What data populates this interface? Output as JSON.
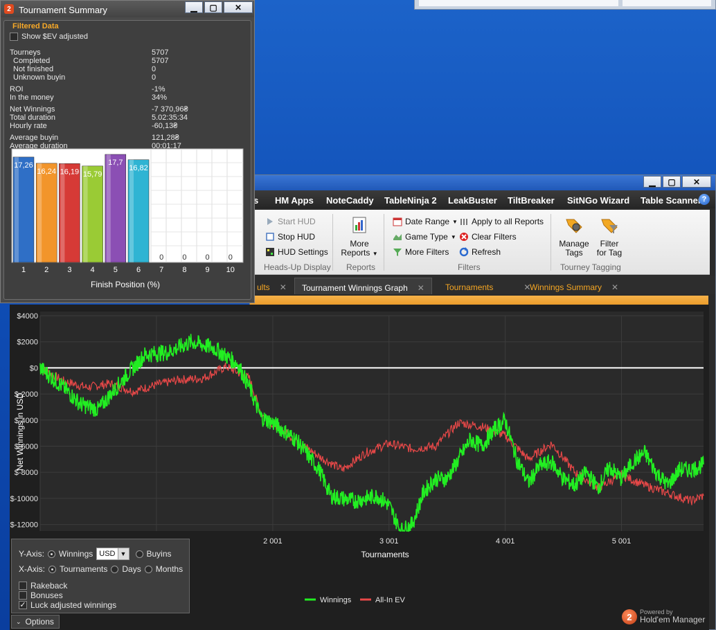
{
  "summary": {
    "title": "Tournament Summary",
    "logo": "2",
    "section": "Filtered Data",
    "ev_checkbox": "Show $EV adjusted",
    "stats": [
      {
        "label": "Tourneys",
        "value": "5707"
      },
      {
        "label": "Completed",
        "value": "5707"
      },
      {
        "label": "Not finished",
        "value": "0"
      },
      {
        "label": "Unknown buyin",
        "value": "0"
      },
      {
        "label": "ROI",
        "value": "-1%"
      },
      {
        "label": "In the money",
        "value": "34%"
      },
      {
        "label": "Net Winnings",
        "value": "-7 370,96₴"
      },
      {
        "label": "Total duration",
        "value": "5.02:35:34"
      },
      {
        "label": "Hourly rate",
        "value": "-60,13₴"
      },
      {
        "label": "Average buyin",
        "value": "121,28₴"
      },
      {
        "label": "Average duration",
        "value": "00:01:17"
      }
    ],
    "finish_chart": {
      "type": "bar",
      "xlabel": "Finish Position (%)",
      "categories": [
        "1",
        "2",
        "3",
        "4",
        "5",
        "6",
        "7",
        "8",
        "9",
        "10"
      ],
      "values": [
        17.26,
        16.24,
        16.19,
        15.79,
        17.7,
        16.82,
        0,
        0,
        0,
        0
      ],
      "labels": [
        "17,26",
        "16,24",
        "16,19",
        "15,79",
        "17,7",
        "16,82",
        "0",
        "0",
        "0",
        "0"
      ],
      "colors": [
        "#2f6fc6",
        "#f2952b",
        "#d63a36",
        "#9acb35",
        "#8b4fb4",
        "#2fb4d3"
      ]
    }
  },
  "main": {
    "menu": [
      "s",
      "HM Apps",
      "NoteCaddy",
      "TableNinja 2",
      "LeakBuster",
      "TiltBreaker",
      "SitNGo Wizard",
      "Table Scanner"
    ],
    "ribbon": {
      "hud": {
        "start": "Start HUD",
        "stop": "Stop HUD",
        "settings": "HUD Settings",
        "group": "Heads-Up Display"
      },
      "reports": {
        "more_line1": "More",
        "more_line2": "Reports",
        "group": "Reports"
      },
      "filters": {
        "date_range": "Date Range",
        "game_type": "Game Type",
        "more_filters": "More Filters",
        "apply_all": "Apply to all Reports",
        "clear": "Clear Filters",
        "refresh": "Refresh",
        "group": "Filters"
      },
      "tagging": {
        "manage_l1": "Manage",
        "manage_l2": "Tags",
        "filter_l1": "Filter",
        "filter_l2": "for Tag",
        "group": "Tourney Tagging"
      }
    },
    "tabs": [
      {
        "label": "ults",
        "active": false
      },
      {
        "label": "Tournament Winnings Graph",
        "active": true
      },
      {
        "label": "Tournaments",
        "active": false
      },
      {
        "label": "Winnings Summary",
        "active": false
      }
    ],
    "options": {
      "y_axis_label": "Y-Axis:",
      "winnings": "Winnings",
      "currency": "USD",
      "buyins": "Buyins",
      "x_axis_label": "X-Axis:",
      "tournaments": "Tournaments",
      "days": "Days",
      "months": "Months",
      "rakeback": "Rakeback",
      "bonuses": "Bonuses",
      "luck_adjusted": "Luck adjusted winnings",
      "toggle": "Options"
    },
    "powered": {
      "small": "Powered by",
      "big": "Hold'em Manager",
      "logo": "2"
    }
  },
  "chart_data": {
    "type": "line",
    "xlabel": "Tournaments",
    "ylabel": "Net Winnings in USD",
    "y_ticks": [
      "$4000",
      "$2000",
      "$0",
      "$-2000",
      "$-4000",
      "$-6000",
      "$-8000",
      "$-10000",
      "$-12000"
    ],
    "x_ticks": [
      "2 001",
      "3 001",
      "4 001",
      "5 001"
    ],
    "ylim": [
      -12500,
      4000
    ],
    "xlim": [
      0,
      5707
    ],
    "series": [
      {
        "name": "Winnings",
        "color": "#22ee22",
        "x": [
          0,
          200,
          350,
          500,
          700,
          900,
          1100,
          1300,
          1500,
          1700,
          1800,
          1900,
          2000,
          2200,
          2400,
          2500,
          2700,
          2900,
          3000,
          3100,
          3200,
          3300,
          3400,
          3500,
          3600,
          3700,
          3800,
          3900,
          4000,
          4100,
          4200,
          4300,
          4400,
          4500,
          4600,
          4700,
          4800,
          4900,
          5000,
          5100,
          5200,
          5300,
          5400,
          5500,
          5600,
          5707
        ],
        "y": [
          0,
          -1500,
          -2800,
          -3200,
          -1000,
          1000,
          1200,
          2000,
          1500,
          300,
          -1500,
          -3800,
          -4200,
          -5500,
          -7800,
          -9800,
          -10200,
          -9800,
          -10500,
          -12500,
          -12000,
          -9500,
          -8500,
          -8500,
          -7000,
          -5500,
          -6000,
          -4800,
          -4000,
          -7000,
          -8800,
          -7500,
          -7200,
          -8500,
          -9000,
          -8000,
          -9200,
          -7600,
          -8500,
          -7200,
          -6500,
          -8000,
          -9000,
          -7800,
          -7800,
          -7400
        ]
      },
      {
        "name": "All-In EV",
        "color": "#e84848",
        "x": [
          0,
          200,
          400,
          600,
          800,
          1000,
          1200,
          1400,
          1600,
          1800,
          1900,
          2000,
          2200,
          2400,
          2600,
          2800,
          3000,
          3200,
          3400,
          3600,
          3800,
          4000,
          4200,
          4400,
          4600,
          4800,
          5000,
          5200,
          5400,
          5600,
          5707
        ],
        "y": [
          0,
          -1000,
          -1500,
          -1200,
          -1800,
          -1300,
          -900,
          -800,
          100,
          -800,
          -3500,
          -4300,
          -5500,
          -6800,
          -7800,
          -6500,
          -5800,
          -6200,
          -6000,
          -4200,
          -4500,
          -5200,
          -7000,
          -5800,
          -8000,
          -9200,
          -8200,
          -9000,
          -9600,
          -10200,
          -9800
        ]
      }
    ]
  }
}
